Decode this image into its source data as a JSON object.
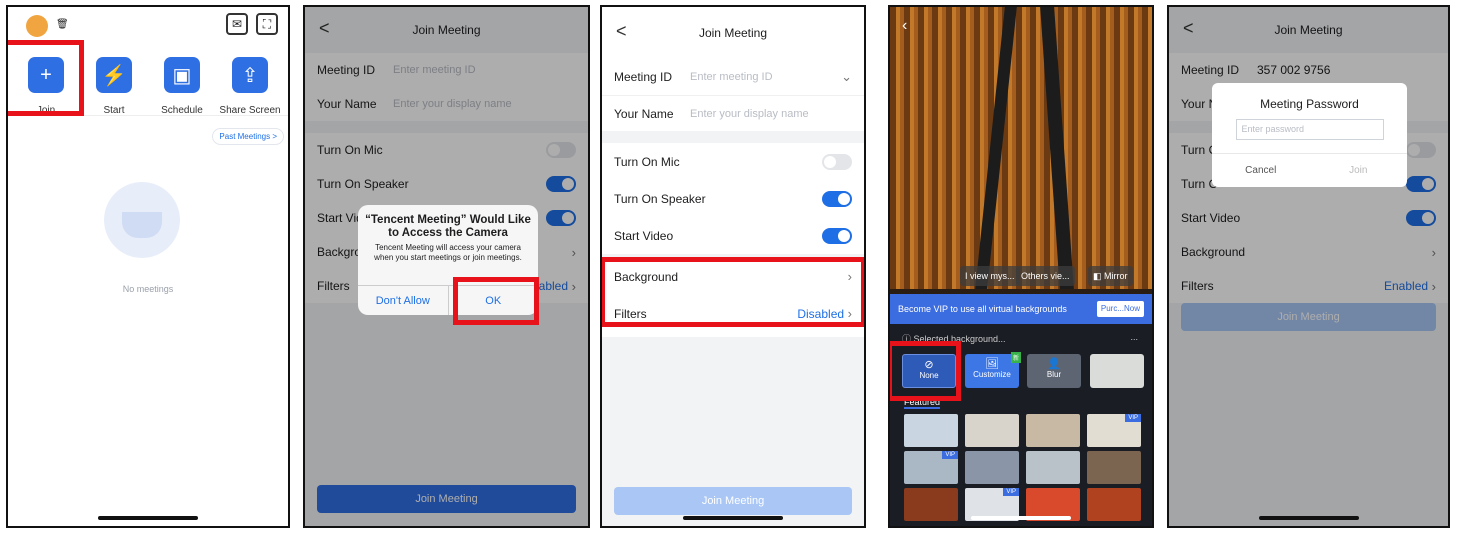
{
  "home": {
    "tiles": [
      {
        "label": "Join",
        "icon": "+"
      },
      {
        "label": "Start",
        "icon": "⚡"
      },
      {
        "label": "Schedule",
        "icon": "▣"
      },
      {
        "label": "Share Screen",
        "icon": "⇪"
      }
    ],
    "past_meetings": "Past Meetings >",
    "empty": "No meetings"
  },
  "join": {
    "title": "Join Meeting",
    "meeting_id_label": "Meeting ID",
    "meeting_id_placeholder": "Enter meeting ID",
    "name_label": "Your Name",
    "name_placeholder": "Enter your display name",
    "mic_label": "Turn On Mic",
    "speaker_label": "Turn On Speaker",
    "video_label": "Start Video",
    "background_label": "Background",
    "filters_label": "Filters",
    "filters_disabled": "Disabled",
    "filters_enabled": "Enabled",
    "join_button": "Join Meeting",
    "partial_video": "Start Vid",
    "partial_background": "Backgro",
    "partial_enabled": "abled"
  },
  "camera_alert": {
    "title": "“Tencent Meeting” Would Like to Access the Camera",
    "body": "Tencent Meeting will access your camera when you start meetings or join meetings.",
    "deny": "Don't Allow",
    "allow": "OK"
  },
  "backgrounds": {
    "view_mine": "I view mys...",
    "others_view": "Others vie...",
    "mirror": "Mirror",
    "vip_banner": "Become VIP to use all virtual backgrounds",
    "purchase": "Purc...Now",
    "selected": "ⓘ Selected background...",
    "more": "...",
    "none": "None",
    "customize": "Customize",
    "blur": "Blur",
    "featured": "Featured",
    "vip_tag": "VIP",
    "new_tag": "新"
  },
  "password": {
    "meeting_id": "357 002 9756",
    "title": "Meeting Password",
    "placeholder": "Enter password",
    "cancel": "Cancel",
    "join": "Join",
    "partial_name": "Your N",
    "partial_mic": "Turn O",
    "partial_speaker": "Turn O"
  },
  "colors": {
    "accent": "#1e6fe6",
    "highlight": "#e8121b"
  }
}
